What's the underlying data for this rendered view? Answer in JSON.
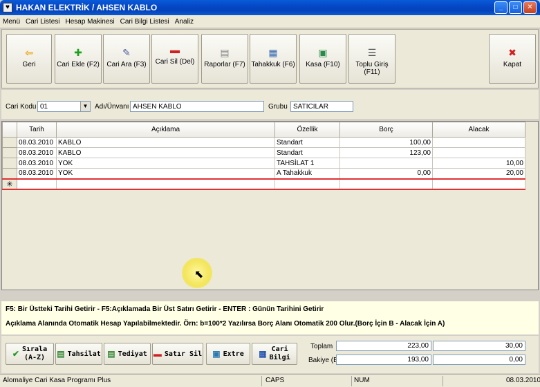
{
  "window": {
    "title": "HAKAN ELEKTRİK / AHSEN KABLO",
    "minimize": "_",
    "maximize": "□",
    "close": "✕"
  },
  "menu": [
    "Menü",
    "Cari Listesi",
    "Hesap Makinesi",
    "Cari Bilgi Listesi",
    "Analiz"
  ],
  "toolbar": {
    "geri": "Geri",
    "cari_ekle": "Cari Ekle (F2)",
    "cari_ara": "Cari Ara (F3)",
    "cari_sil": "Cari Sil (Del)",
    "raporlar": "Raporlar (F7)",
    "tahakkuk": "Tahakkuk (F6)",
    "kasa": "Kasa (F10)",
    "toplu_giris": "Toplu Giriş (F11)",
    "kapat": "Kapat"
  },
  "form": {
    "cari_kodu_label": "Cari Kodu",
    "cari_kodu_value": "01",
    "adi_label": "Adı/Ünvanı",
    "adi_value": "AHSEN KABLO",
    "grubu_label": "Grubu",
    "grubu_value": "SATICILAR"
  },
  "grid": {
    "headers": {
      "tarih": "Tarih",
      "aciklama": "Açıklama",
      "ozellik": "Özellik",
      "borc": "Borç",
      "alacak": "Alacak"
    },
    "rows": [
      {
        "tarih": "08.03.2010",
        "aciklama": "KABLO",
        "ozellik": "Standart",
        "borc": "100,00",
        "alacak": ""
      },
      {
        "tarih": "08.03.2010",
        "aciklama": "KABLO",
        "ozellik": "Standart",
        "borc": "123,00",
        "alacak": ""
      },
      {
        "tarih": "08.03.2010",
        "aciklama": "YOK",
        "ozellik": "TAHSİLAT 1",
        "borc": "",
        "alacak": "10,00"
      },
      {
        "tarih": "08.03.2010",
        "aciklama": "YOK",
        "ozellik": "A Tahakkuk",
        "borc": "0,00",
        "alacak": "20,00"
      }
    ],
    "new_row_marker": "✳"
  },
  "info": {
    "line1": "F5: Bir Üstteki Tarihi Getirir - F5:Açıklamada Bir Üst Satırı Getirir - ENTER : Günün Tarihini Getirir",
    "line2": "Açıklama Alanında Otomatik Hesap Yapılabilmektedir. Örn: b=100*2 Yazılırsa Borç Alanı Otomatik 200 Olur.(Borç İçin B  -  Alacak İçin A)"
  },
  "bottom_buttons": {
    "sirala_line1": "Sırala",
    "sirala_line2": "(A-Z)",
    "tahsilat": "Tahsilat",
    "tediyat": "Tediyat",
    "satir_sil": "Satır Sil",
    "extre": "Extre",
    "cari_bilgi_line1": "Cari",
    "cari_bilgi_line2": "Bilgi"
  },
  "totals": {
    "toplam_label": "Toplam",
    "toplam_borc": "223,00",
    "toplam_alacak": "30,00",
    "bakiye_label": "Bakiye (B)",
    "bakiye_borc": "193,00",
    "bakiye_alacak": "0,00"
  },
  "status": {
    "app": "Alomaliye Cari Kasa Programı Plus",
    "caps": "CAPS",
    "num": "NUM",
    "date": "08.03.2010"
  },
  "colors": {
    "title_bar": "#0548c6",
    "new_row_border": "#e03030",
    "info_bg": "#ffffe6"
  }
}
